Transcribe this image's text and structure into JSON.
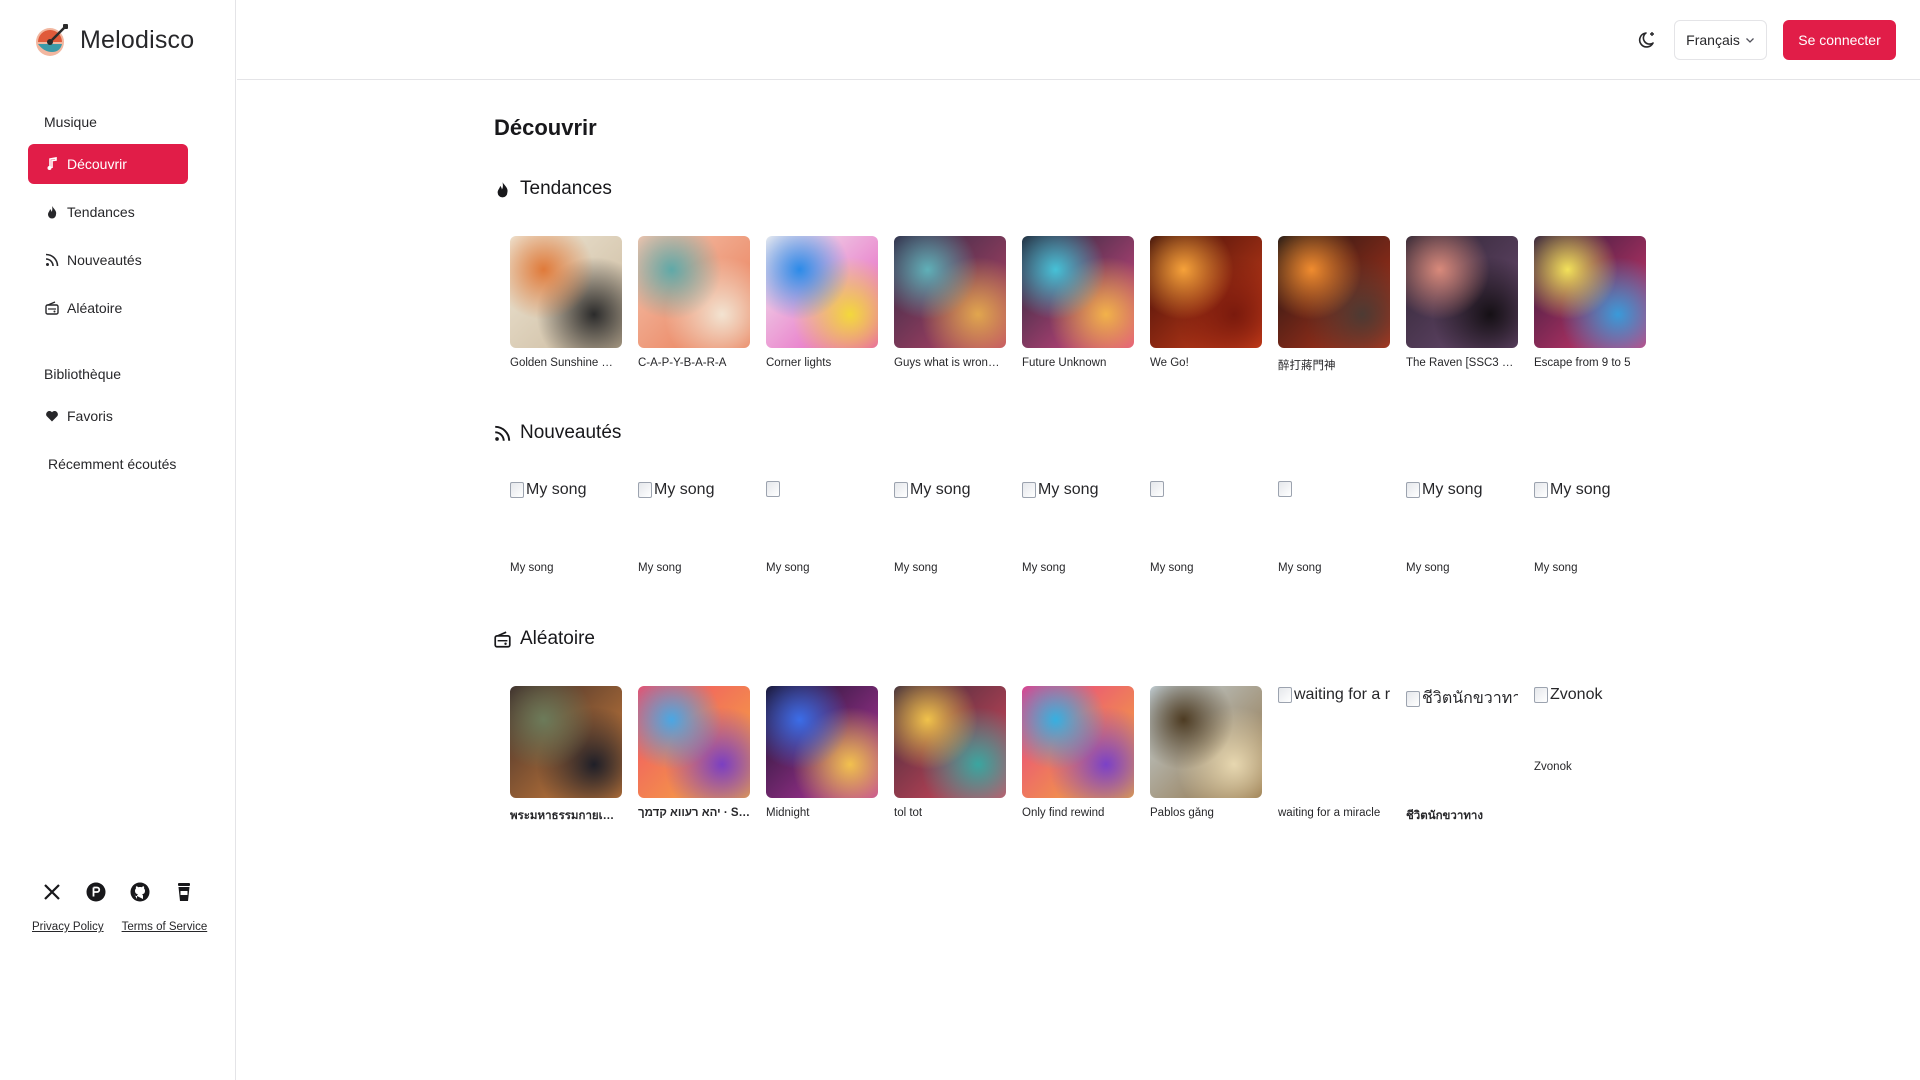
{
  "app": {
    "name": "Melodisco"
  },
  "sidebar": {
    "music_section": "Musique",
    "library_section": "Bibliothèque",
    "items": [
      {
        "label": "Découvrir",
        "icon": "music-note-icon"
      },
      {
        "label": "Tendances",
        "icon": "flame-icon"
      },
      {
        "label": "Nouveautés",
        "icon": "rss-icon"
      },
      {
        "label": "Aléatoire",
        "icon": "radio-icon"
      },
      {
        "label": "Favoris",
        "icon": "heart-icon"
      },
      {
        "label": "Récemment écoutés",
        "icon": ""
      }
    ],
    "social": [
      "x-icon",
      "product-hunt-icon",
      "github-icon",
      "coffee-icon"
    ],
    "privacy": "Privacy Policy",
    "terms": "Terms of Service"
  },
  "header": {
    "language": "Français",
    "login": "Se connecter"
  },
  "main": {
    "title": "Découvrir",
    "trending": {
      "title": "Tendances",
      "tracks": [
        {
          "name": "Golden Sunshine …",
          "colors": [
            "#efe7d6",
            "#c9b79b",
            "#e07a3a",
            "#2b2b2b"
          ]
        },
        {
          "name": "C-A-P-Y-B-A-R-A",
          "colors": [
            "#f4c6b0",
            "#e9764f",
            "#5fa9a8",
            "#f2e3d1"
          ]
        },
        {
          "name": "Corner lights",
          "colors": [
            "#f1f1f1",
            "#e64dbb",
            "#2c8be8",
            "#f3d83b"
          ]
        },
        {
          "name": "Guys what is wron…",
          "colors": [
            "#2d2a45",
            "#c2456a",
            "#5fb0b8",
            "#e1a64e"
          ]
        },
        {
          "name": "Future Unknown",
          "colors": [
            "#1d2838",
            "#e64a8a",
            "#46c1d7",
            "#f2b24a"
          ]
        },
        {
          "name": "We Go!",
          "colors": [
            "#3a0c08",
            "#d7421b",
            "#f6a23a",
            "#7a1a0d"
          ]
        },
        {
          "name": "醉打蔣門神",
          "colors": [
            "#1a1414",
            "#c1371b",
            "#f08c2f",
            "#4d3a33"
          ]
        },
        {
          "name": "The Raven [SSC3 …",
          "colors": [
            "#2d2431",
            "#6d4c73",
            "#d98a7b",
            "#151015"
          ]
        },
        {
          "name": "Escape from 9 to 5",
          "colors": [
            "#2a1a3a",
            "#e23a72",
            "#f2e15a",
            "#3a9ad9"
          ]
        }
      ]
    },
    "new": {
      "title": "Nouveautés",
      "tracks": [
        {
          "name": "My song",
          "alt": "My song"
        },
        {
          "name": "My song",
          "alt": "My song"
        },
        {
          "name": "My song",
          "alt": ""
        },
        {
          "name": "My song",
          "alt": "My song"
        },
        {
          "name": "My song",
          "alt": "My song"
        },
        {
          "name": "My song",
          "alt": ""
        },
        {
          "name": "My song",
          "alt": ""
        },
        {
          "name": "My song",
          "alt": "My song"
        },
        {
          "name": "My song",
          "alt": "My song"
        }
      ]
    },
    "random": {
      "title": "Aléatoire",
      "tracks": [
        {
          "name": "พระมหาธรรมกายเ…",
          "colors": [
            "#3b2c2a",
            "#d9853d",
            "#6c7b5a",
            "#1f1f28"
          ],
          "bold": true
        },
        {
          "name": "יהא רעווא קדמך · S…",
          "colors": [
            "#ef4b6b",
            "#f6b13b",
            "#4aa7e4",
            "#7b3fc2"
          ],
          "bold": true
        },
        {
          "name": "Midnight",
          "colors": [
            "#15122b",
            "#c13aa8",
            "#3b6de8",
            "#f2c14e"
          ]
        },
        {
          "name": "tol tot",
          "colors": [
            "#3a2a3a",
            "#e44a5f",
            "#f0c24b",
            "#3aa6a0"
          ]
        },
        {
          "name": "Only find rewind",
          "colors": [
            "#e73a8b",
            "#f5b532",
            "#36b0e1",
            "#7b41c7"
          ]
        },
        {
          "name": "Pablos gång",
          "colors": [
            "#c7d6de",
            "#8b6a3b",
            "#4d3b22",
            "#e7d7b0"
          ]
        },
        {
          "name": "waiting for a miracle",
          "alt": "waiting for a r"
        },
        {
          "name": "ชีวิตนักขวาทาง",
          "alt": "ชีวิตนักขวาทาง",
          "bold": true
        },
        {
          "name": "Zvonok",
          "alt": "Zvonok"
        }
      ]
    }
  }
}
